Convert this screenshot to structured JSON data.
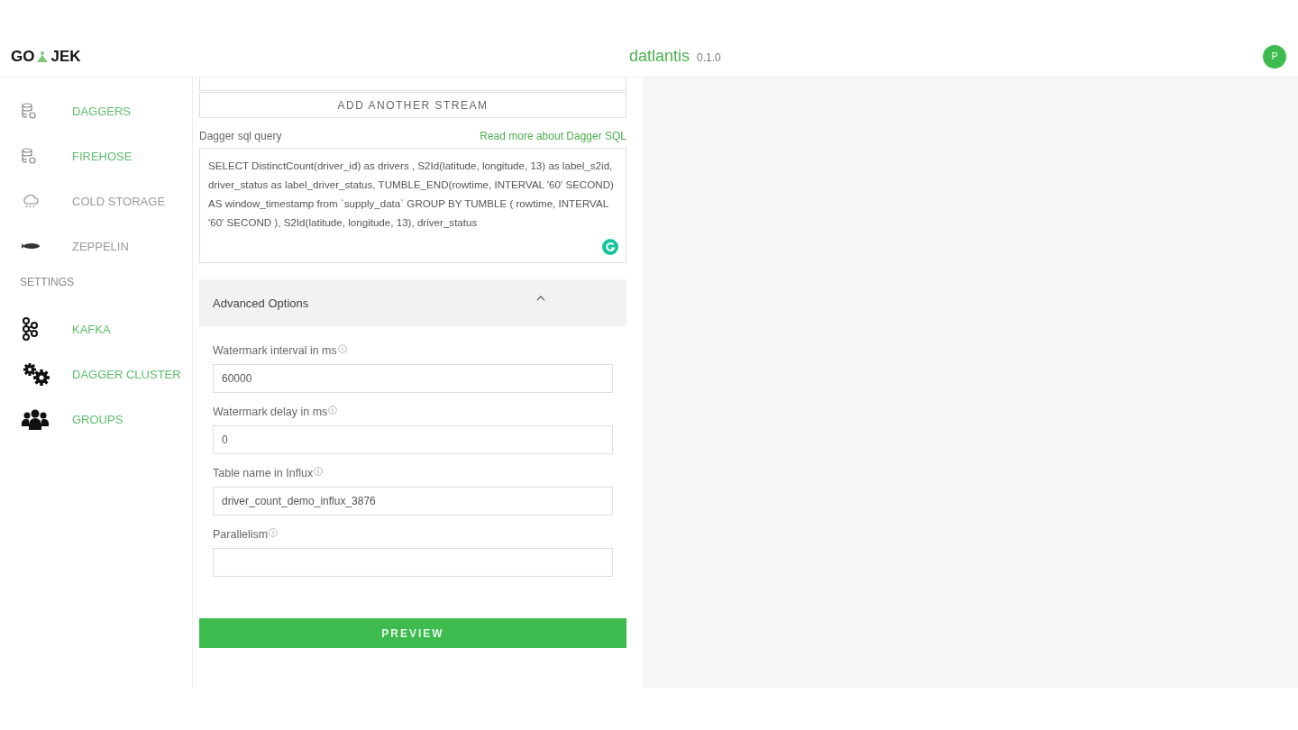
{
  "header": {
    "logo_left": "GO",
    "logo_right": "JEK",
    "app_name": "datlantis",
    "version": "0.1.0",
    "avatar": "P"
  },
  "sidebar": {
    "sections": [
      {
        "items": [
          {
            "label": "DAGGERS",
            "kind": "database",
            "disabled": false
          },
          {
            "label": "FIREHOSE",
            "kind": "database",
            "disabled": false
          },
          {
            "label": "COLD STORAGE",
            "kind": "cloud",
            "disabled": true
          },
          {
            "label": "ZEPPELIN",
            "kind": "zeppelin",
            "disabled": true
          }
        ]
      },
      {
        "title": "SETTINGS",
        "items": [
          {
            "label": "KAFKA",
            "kind": "kafka",
            "disabled": false
          },
          {
            "label": "DAGGER CLUSTER",
            "kind": "gears",
            "disabled": false
          },
          {
            "label": "GROUPS",
            "kind": "group",
            "disabled": false
          }
        ]
      }
    ]
  },
  "form": {
    "add_stream": "ADD ANOTHER STREAM",
    "query_label": "Dagger sql query",
    "query_link": "Read more about Dagger SQL",
    "query": "SELECT DistinctCount(driver_id) as drivers , S2Id(latitude, longitude, 13) as label_s2id, driver_status as label_driver_status, TUMBLE_END(rowtime, INTERVAL '60' SECOND) AS window_timestamp from `supply_data` GROUP BY TUMBLE ( rowtime, INTERVAL '60' SECOND ), S2Id(latitude, longitude, 13), driver_status",
    "advanced": {
      "title": "Advanced Options",
      "expanded": true
    },
    "fields": [
      {
        "label": "Watermark interval in ms",
        "value": "60000"
      },
      {
        "label": "Watermark delay in ms",
        "value": "0"
      },
      {
        "label": "Table name in Influx",
        "value": "driver_count_demo_influx_3876"
      },
      {
        "label": "Parallelism"
      }
    ],
    "preview": "PREVIEW"
  }
}
